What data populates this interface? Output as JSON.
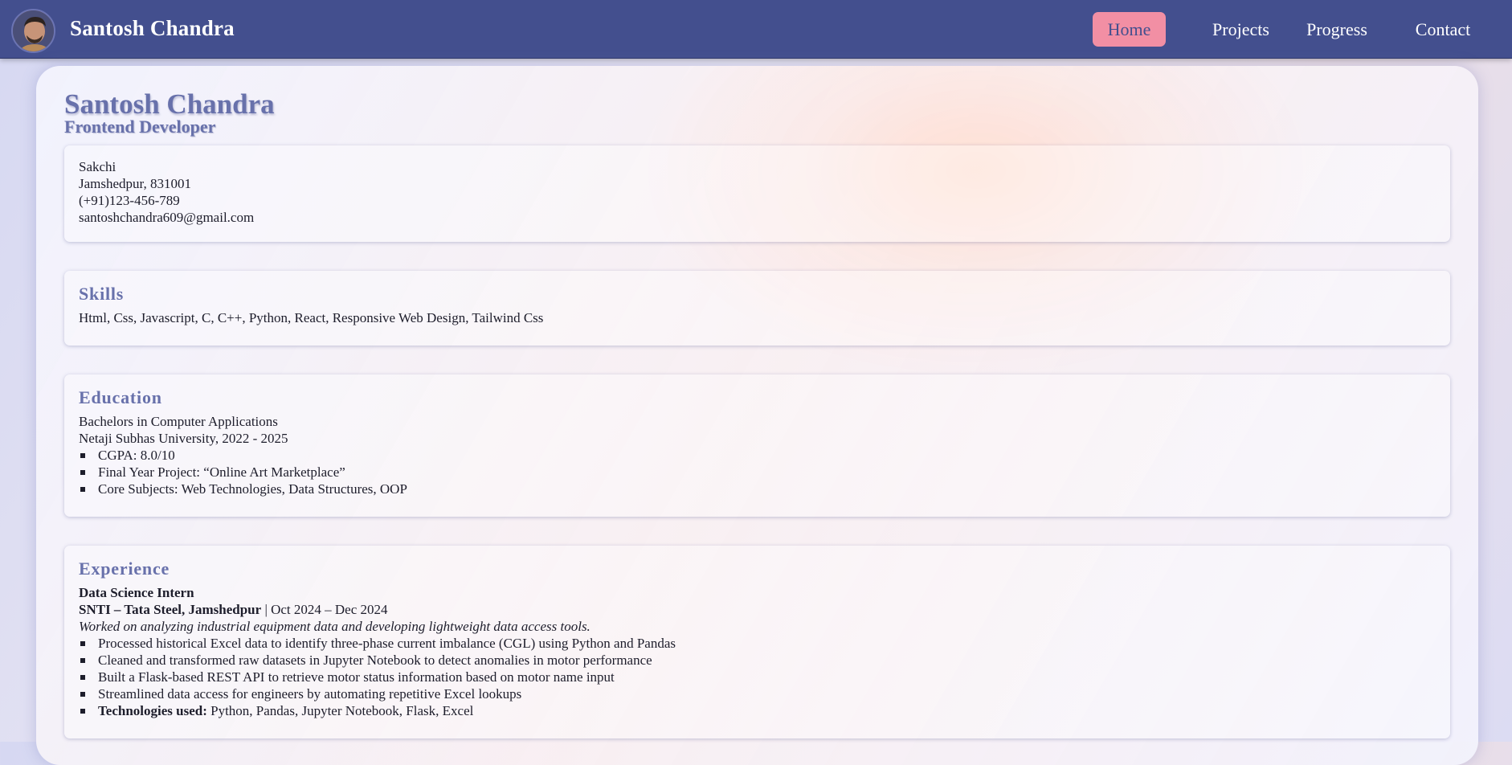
{
  "navbar": {
    "brand": "Santosh Chandra",
    "links": [
      {
        "label": "Home",
        "active": true
      },
      {
        "label": "Projects",
        "active": false
      },
      {
        "label": "Progress",
        "active": false
      },
      {
        "label": "Contact",
        "active": false
      }
    ]
  },
  "hero": {
    "name": "Santosh Chandra",
    "title": "Frontend Developer"
  },
  "contact": {
    "line1": "Sakchi",
    "line2": "Jamshedpur, 831001",
    "phone": "(+91)123-456-789",
    "email": "santoshchandra609@gmail.com"
  },
  "skills": {
    "heading": "Skills",
    "list": "Html, Css, Javascript, C, C++, Python, React, Responsive Web Design, Tailwind Css"
  },
  "education": {
    "heading": "Education",
    "degree": "Bachelors in Computer Applications",
    "university": "Netaji Subhas University, 2022 - 2025",
    "items": [
      "CGPA: 8.0/10",
      "Final Year Project: “Online Art Marketplace”",
      "Core Subjects: Web Technologies, Data Structures, OOP"
    ]
  },
  "experience": {
    "heading": "Experience",
    "role": "Data Science Intern",
    "company": "SNTI – Tata Steel, Jamshedpur",
    "period": " | Oct 2024 – Dec 2024",
    "summary": "Worked on analyzing industrial equipment data and developing lightweight data access tools.",
    "items": [
      "Processed historical Excel data to identify three-phase current imbalance (CGL) using Python and Pandas",
      "Cleaned and transformed raw datasets in Jupyter Notebook to detect anomalies in motor performance",
      "Built a Flask-based REST API to retrieve motor status information based on motor name input",
      "Streamlined data access for engineers by automating repetitive Excel lookups"
    ],
    "tech_label": "Technologies used:",
    "tech_value": " Python, Pandas, Jupyter Notebook, Flask, Excel"
  }
}
